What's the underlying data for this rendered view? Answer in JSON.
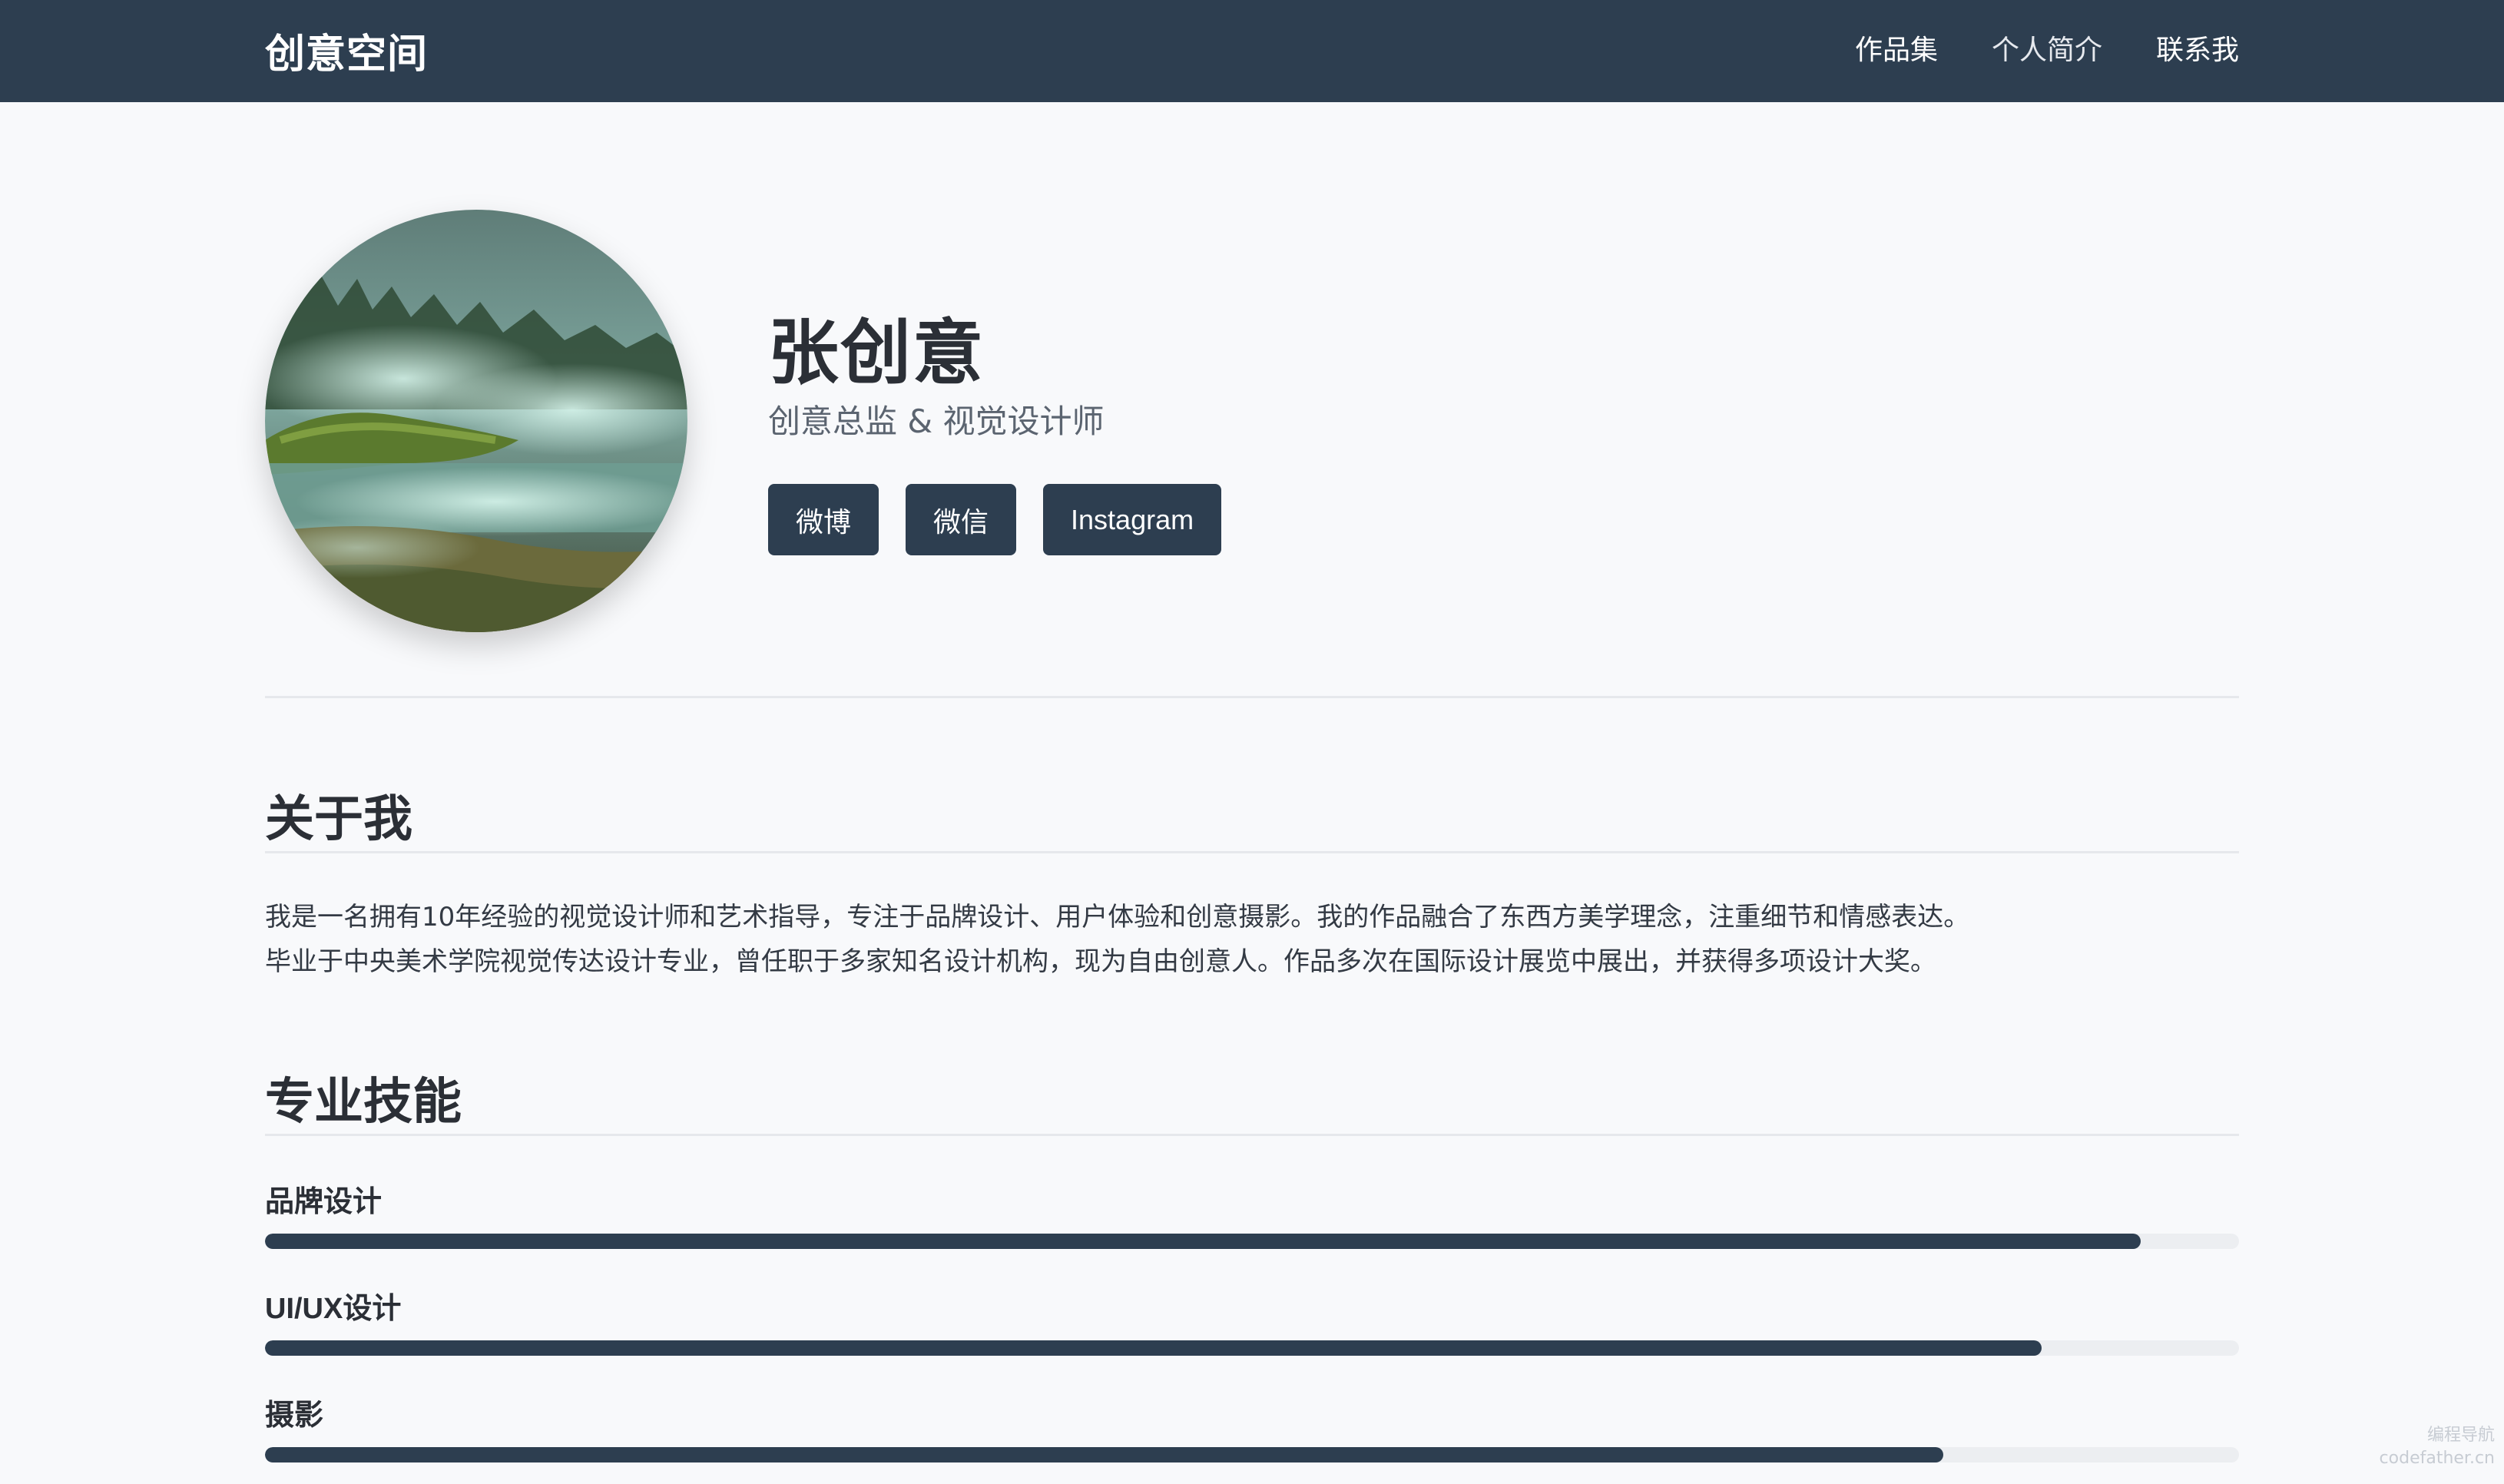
{
  "navbar": {
    "brand": "创意空间",
    "links": [
      "作品集",
      "个人简介",
      "联系我"
    ]
  },
  "profile": {
    "name": "张创意",
    "title": "创意总监 & 视觉设计师",
    "photo_icon": "misty-landscape-photo",
    "social": [
      "微博",
      "微信",
      "Instagram"
    ]
  },
  "about": {
    "heading": "关于我",
    "paragraphs": [
      "我是一名拥有10年经验的视觉设计师和艺术指导，专注于品牌设计、用户体验和创意摄影。我的作品融合了东西方美学理念，注重细节和情感表达。",
      "毕业于中央美术学院视觉传达设计专业，曾任职于多家知名设计机构，现为自由创意人。作品多次在国际设计展览中展出，并获得多项设计大奖。"
    ]
  },
  "skills": {
    "heading": "专业技能",
    "items": [
      {
        "label": "品牌设计",
        "level": 0.95
      },
      {
        "label": "UI/UX设计",
        "level": 0.9
      },
      {
        "label": "摄影",
        "level": 0.85
      }
    ]
  },
  "watermark": {
    "line1": "编程导航",
    "line2": "codefather.cn"
  },
  "colors": {
    "navbar": "#2d3e50",
    "accent": "#2d3e50",
    "background": "#f8f9fb",
    "track": "#eceef1"
  }
}
